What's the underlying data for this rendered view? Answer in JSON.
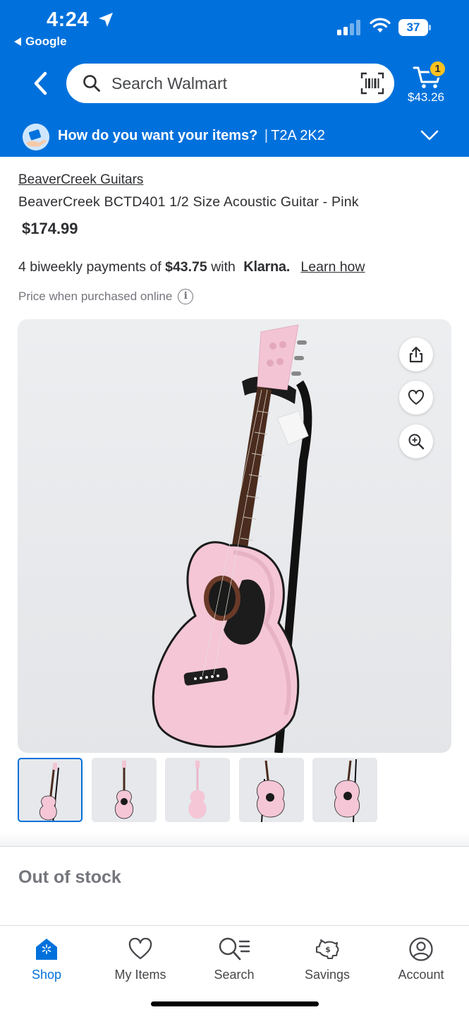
{
  "status_bar": {
    "time": "4:24",
    "back_app": "Google",
    "battery": "37"
  },
  "header": {
    "search_placeholder": "Search Walmart",
    "cart_count": "1",
    "cart_total": "$43.26",
    "delivery_question": "How do you want your items?",
    "delivery_separator": "|",
    "delivery_postal": "T2A 2K2"
  },
  "product": {
    "brand": "BeaverCreek Guitars",
    "title": "BeaverCreek BCTD401 1/2 Size Acoustic Guitar - Pink",
    "price": "$174.99",
    "klarna_prefix": "4 biweekly payments of",
    "klarna_amount": "$43.75",
    "klarna_with": "with",
    "klarna_brand": "Klarna.",
    "klarna_learn": "Learn how",
    "price_note": "Price when purchased online",
    "info_glyph": "i",
    "thumbnail_count": 5,
    "selected_thumbnail": 1,
    "stock_status": "Out of stock"
  },
  "nav": {
    "items": [
      {
        "label": "Shop",
        "icon": "shop-icon"
      },
      {
        "label": "My Items",
        "icon": "heart-icon"
      },
      {
        "label": "Search",
        "icon": "search-list-icon"
      },
      {
        "label": "Savings",
        "icon": "piggy-bank-icon"
      },
      {
        "label": "Account",
        "icon": "account-icon"
      }
    ]
  },
  "colors": {
    "brand_blue": "#0071dc",
    "badge_yellow": "#ffc220",
    "guitar_pink": "#f4c6d6"
  }
}
